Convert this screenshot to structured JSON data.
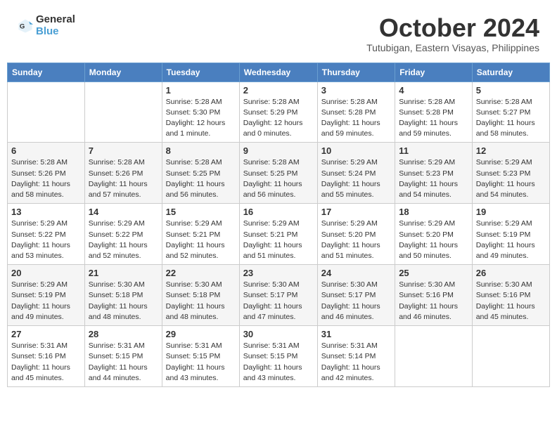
{
  "header": {
    "logo_line1": "General",
    "logo_line2": "Blue",
    "month": "October 2024",
    "location": "Tutubigan, Eastern Visayas, Philippines"
  },
  "weekdays": [
    "Sunday",
    "Monday",
    "Tuesday",
    "Wednesday",
    "Thursday",
    "Friday",
    "Saturday"
  ],
  "weeks": [
    [
      {
        "day": "",
        "sunrise": "",
        "sunset": "",
        "daylight": ""
      },
      {
        "day": "",
        "sunrise": "",
        "sunset": "",
        "daylight": ""
      },
      {
        "day": "1",
        "sunrise": "Sunrise: 5:28 AM",
        "sunset": "Sunset: 5:30 PM",
        "daylight": "Daylight: 12 hours and 1 minute."
      },
      {
        "day": "2",
        "sunrise": "Sunrise: 5:28 AM",
        "sunset": "Sunset: 5:29 PM",
        "daylight": "Daylight: 12 hours and 0 minutes."
      },
      {
        "day": "3",
        "sunrise": "Sunrise: 5:28 AM",
        "sunset": "Sunset: 5:28 PM",
        "daylight": "Daylight: 11 hours and 59 minutes."
      },
      {
        "day": "4",
        "sunrise": "Sunrise: 5:28 AM",
        "sunset": "Sunset: 5:28 PM",
        "daylight": "Daylight: 11 hours and 59 minutes."
      },
      {
        "day": "5",
        "sunrise": "Sunrise: 5:28 AM",
        "sunset": "Sunset: 5:27 PM",
        "daylight": "Daylight: 11 hours and 58 minutes."
      }
    ],
    [
      {
        "day": "6",
        "sunrise": "Sunrise: 5:28 AM",
        "sunset": "Sunset: 5:26 PM",
        "daylight": "Daylight: 11 hours and 58 minutes."
      },
      {
        "day": "7",
        "sunrise": "Sunrise: 5:28 AM",
        "sunset": "Sunset: 5:26 PM",
        "daylight": "Daylight: 11 hours and 57 minutes."
      },
      {
        "day": "8",
        "sunrise": "Sunrise: 5:28 AM",
        "sunset": "Sunset: 5:25 PM",
        "daylight": "Daylight: 11 hours and 56 minutes."
      },
      {
        "day": "9",
        "sunrise": "Sunrise: 5:28 AM",
        "sunset": "Sunset: 5:25 PM",
        "daylight": "Daylight: 11 hours and 56 minutes."
      },
      {
        "day": "10",
        "sunrise": "Sunrise: 5:29 AM",
        "sunset": "Sunset: 5:24 PM",
        "daylight": "Daylight: 11 hours and 55 minutes."
      },
      {
        "day": "11",
        "sunrise": "Sunrise: 5:29 AM",
        "sunset": "Sunset: 5:23 PM",
        "daylight": "Daylight: 11 hours and 54 minutes."
      },
      {
        "day": "12",
        "sunrise": "Sunrise: 5:29 AM",
        "sunset": "Sunset: 5:23 PM",
        "daylight": "Daylight: 11 hours and 54 minutes."
      }
    ],
    [
      {
        "day": "13",
        "sunrise": "Sunrise: 5:29 AM",
        "sunset": "Sunset: 5:22 PM",
        "daylight": "Daylight: 11 hours and 53 minutes."
      },
      {
        "day": "14",
        "sunrise": "Sunrise: 5:29 AM",
        "sunset": "Sunset: 5:22 PM",
        "daylight": "Daylight: 11 hours and 52 minutes."
      },
      {
        "day": "15",
        "sunrise": "Sunrise: 5:29 AM",
        "sunset": "Sunset: 5:21 PM",
        "daylight": "Daylight: 11 hours and 52 minutes."
      },
      {
        "day": "16",
        "sunrise": "Sunrise: 5:29 AM",
        "sunset": "Sunset: 5:21 PM",
        "daylight": "Daylight: 11 hours and 51 minutes."
      },
      {
        "day": "17",
        "sunrise": "Sunrise: 5:29 AM",
        "sunset": "Sunset: 5:20 PM",
        "daylight": "Daylight: 11 hours and 51 minutes."
      },
      {
        "day": "18",
        "sunrise": "Sunrise: 5:29 AM",
        "sunset": "Sunset: 5:20 PM",
        "daylight": "Daylight: 11 hours and 50 minutes."
      },
      {
        "day": "19",
        "sunrise": "Sunrise: 5:29 AM",
        "sunset": "Sunset: 5:19 PM",
        "daylight": "Daylight: 11 hours and 49 minutes."
      }
    ],
    [
      {
        "day": "20",
        "sunrise": "Sunrise: 5:29 AM",
        "sunset": "Sunset: 5:19 PM",
        "daylight": "Daylight: 11 hours and 49 minutes."
      },
      {
        "day": "21",
        "sunrise": "Sunrise: 5:30 AM",
        "sunset": "Sunset: 5:18 PM",
        "daylight": "Daylight: 11 hours and 48 minutes."
      },
      {
        "day": "22",
        "sunrise": "Sunrise: 5:30 AM",
        "sunset": "Sunset: 5:18 PM",
        "daylight": "Daylight: 11 hours and 48 minutes."
      },
      {
        "day": "23",
        "sunrise": "Sunrise: 5:30 AM",
        "sunset": "Sunset: 5:17 PM",
        "daylight": "Daylight: 11 hours and 47 minutes."
      },
      {
        "day": "24",
        "sunrise": "Sunrise: 5:30 AM",
        "sunset": "Sunset: 5:17 PM",
        "daylight": "Daylight: 11 hours and 46 minutes."
      },
      {
        "day": "25",
        "sunrise": "Sunrise: 5:30 AM",
        "sunset": "Sunset: 5:16 PM",
        "daylight": "Daylight: 11 hours and 46 minutes."
      },
      {
        "day": "26",
        "sunrise": "Sunrise: 5:30 AM",
        "sunset": "Sunset: 5:16 PM",
        "daylight": "Daylight: 11 hours and 45 minutes."
      }
    ],
    [
      {
        "day": "27",
        "sunrise": "Sunrise: 5:31 AM",
        "sunset": "Sunset: 5:16 PM",
        "daylight": "Daylight: 11 hours and 45 minutes."
      },
      {
        "day": "28",
        "sunrise": "Sunrise: 5:31 AM",
        "sunset": "Sunset: 5:15 PM",
        "daylight": "Daylight: 11 hours and 44 minutes."
      },
      {
        "day": "29",
        "sunrise": "Sunrise: 5:31 AM",
        "sunset": "Sunset: 5:15 PM",
        "daylight": "Daylight: 11 hours and 43 minutes."
      },
      {
        "day": "30",
        "sunrise": "Sunrise: 5:31 AM",
        "sunset": "Sunset: 5:15 PM",
        "daylight": "Daylight: 11 hours and 43 minutes."
      },
      {
        "day": "31",
        "sunrise": "Sunrise: 5:31 AM",
        "sunset": "Sunset: 5:14 PM",
        "daylight": "Daylight: 11 hours and 42 minutes."
      },
      {
        "day": "",
        "sunrise": "",
        "sunset": "",
        "daylight": ""
      },
      {
        "day": "",
        "sunrise": "",
        "sunset": "",
        "daylight": ""
      }
    ]
  ]
}
